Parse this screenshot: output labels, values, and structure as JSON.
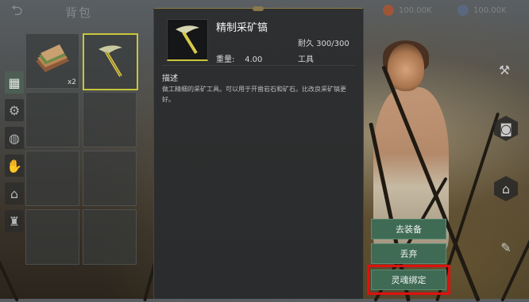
{
  "header": {
    "back_icon": "back-arrow-icon",
    "title": "背包"
  },
  "currencies": [
    {
      "icon": "gold-coin-icon",
      "value": "100.00K",
      "color": "#b5532c"
    },
    {
      "icon": "gem-icon",
      "value": "100.00K",
      "color": "#5a6c8a"
    }
  ],
  "tabs": [
    {
      "icon": "grid-icon",
      "active": true
    },
    {
      "icon": "gear-icon",
      "active": false
    },
    {
      "icon": "ball-icon",
      "active": false
    },
    {
      "icon": "hand-icon",
      "active": false
    },
    {
      "icon": "bank-icon",
      "active": false
    },
    {
      "icon": "trophy-icon",
      "active": false
    }
  ],
  "inventory": {
    "slots": [
      {
        "item": "sandwich",
        "qty": "x2"
      },
      {
        "item": "pickaxe",
        "qty": "",
        "selected": true
      }
    ]
  },
  "tooltip": {
    "name": "精制采矿镐",
    "durability": "耐久 300/300",
    "weight_label": "重量:",
    "weight_value": "4.00",
    "type": "工具",
    "desc_header": "描述",
    "description": "做工精细的采矿工具。可以用于开凿岩石和矿石。比改良采矿镐更好。"
  },
  "actions": {
    "equip": "去装备",
    "discard": "丢弃",
    "soulbind": "灵魂绑定"
  },
  "colors": {
    "accent_green": "#3f6b55",
    "highlight_red": "#e01010",
    "select_yellow": "#c8c63a"
  }
}
